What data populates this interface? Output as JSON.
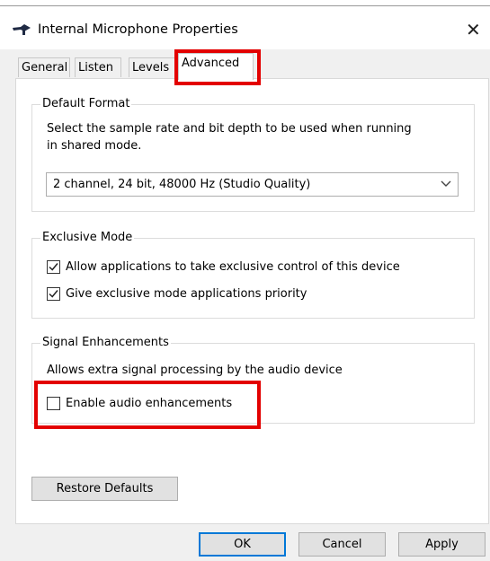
{
  "window": {
    "title": "Internal Microphone Properties",
    "close_glyph": "✕"
  },
  "tabs": [
    {
      "label": "General",
      "active": false
    },
    {
      "label": "Listen",
      "active": false
    },
    {
      "label": "Levels",
      "active": false
    },
    {
      "label": "Advanced",
      "active": true
    }
  ],
  "default_format": {
    "legend": "Default Format",
    "description_line1": "Select the sample rate and bit depth to be used when running",
    "description_line2": "in shared mode.",
    "selected_value": "2 channel, 24 bit, 48000 Hz (Studio Quality)"
  },
  "exclusive_mode": {
    "legend": "Exclusive Mode",
    "options": [
      {
        "label": "Allow applications to take exclusive control of this device",
        "checked": true
      },
      {
        "label": "Give exclusive mode applications priority",
        "checked": true
      }
    ]
  },
  "signal_enhancements": {
    "legend": "Signal Enhancements",
    "description": "Allows extra signal processing by the audio device",
    "option": {
      "label": "Enable audio enhancements",
      "checked": false
    }
  },
  "buttons": {
    "restore_defaults": "Restore Defaults",
    "ok": "OK",
    "cancel": "Cancel",
    "apply": "Apply"
  },
  "highlight_color": "#e30000",
  "icons": [
    "microphone-icon",
    "close-icon",
    "chevron-down-icon",
    "checkmark-icon"
  ]
}
